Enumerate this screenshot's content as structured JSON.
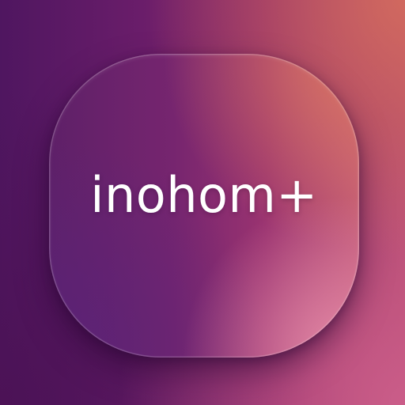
{
  "app_icon": {
    "name": "inohom+"
  }
}
